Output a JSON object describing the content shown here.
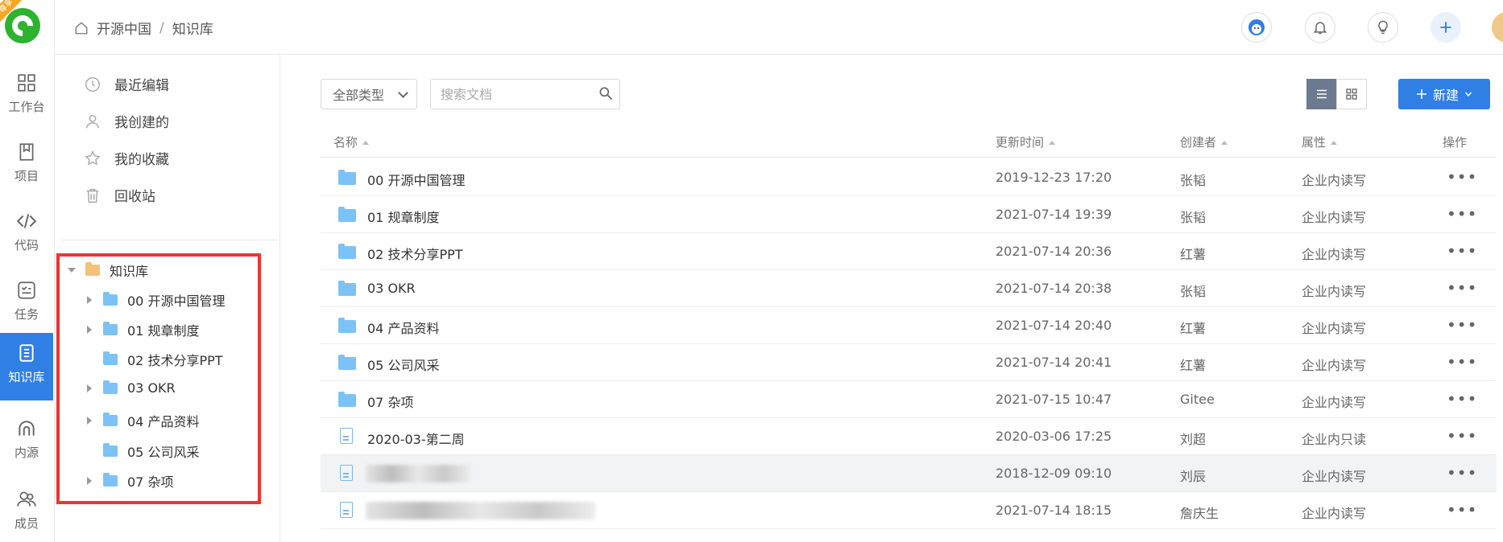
{
  "rail": {
    "badge": "尊享",
    "items": [
      {
        "label": "工作台",
        "icon": "grid-icon"
      },
      {
        "label": "项目",
        "icon": "book-icon"
      },
      {
        "label": "代码",
        "icon": "code-icon"
      },
      {
        "label": "任务",
        "icon": "task-icon"
      },
      {
        "label": "知识库",
        "icon": "doc-icon",
        "active": true
      },
      {
        "label": "内源",
        "icon": "inner-source-icon"
      },
      {
        "label": "成员",
        "icon": "members-icon"
      }
    ]
  },
  "breadcrumb": {
    "root": "开源中国",
    "separator": "/",
    "current": "知识库"
  },
  "side": {
    "menu": [
      "最近编辑",
      "我创建的",
      "我的收藏",
      "回收站"
    ],
    "tree_root": "知识库",
    "tree": [
      {
        "label": "00 开源中国管理",
        "expandable": true
      },
      {
        "label": "01 规章制度",
        "expandable": true
      },
      {
        "label": "02 技术分享PPT",
        "expandable": false
      },
      {
        "label": "03 OKR",
        "expandable": true
      },
      {
        "label": "04 产品资料",
        "expandable": true
      },
      {
        "label": "05 公司风采",
        "expandable": false
      },
      {
        "label": "07 杂项",
        "expandable": true
      }
    ]
  },
  "toolbar": {
    "filter": "全部类型",
    "search_placeholder": "搜索文档",
    "new_label": "新建"
  },
  "table": {
    "headers": {
      "name": "名称",
      "updated": "更新时间",
      "creator": "创建者",
      "attr": "属性",
      "ops": "操作"
    },
    "rows": [
      {
        "type": "folder",
        "name": "00 开源中国管理",
        "updated": "2019-12-23 17:20",
        "creator": "张韬",
        "attr": "企业内读写"
      },
      {
        "type": "folder",
        "name": "01 规章制度",
        "updated": "2021-07-14 19:39",
        "creator": "张韬",
        "attr": "企业内读写"
      },
      {
        "type": "folder",
        "name": "02 技术分享PPT",
        "updated": "2021-07-14 20:36",
        "creator": "红薯",
        "attr": "企业内读写"
      },
      {
        "type": "folder",
        "name": "03 OKR",
        "updated": "2021-07-14 20:38",
        "creator": "张韬",
        "attr": "企业内读写"
      },
      {
        "type": "folder",
        "name": "04 产品资料",
        "updated": "2021-07-14 20:40",
        "creator": "红薯",
        "attr": "企业内读写"
      },
      {
        "type": "folder",
        "name": "05 公司风采",
        "updated": "2021-07-14 20:41",
        "creator": "红薯",
        "attr": "企业内读写"
      },
      {
        "type": "folder",
        "name": "07 杂项",
        "updated": "2021-07-15 10:47",
        "creator": "Gitee",
        "attr": "企业内读写"
      },
      {
        "type": "doc",
        "name": "2020-03-第二周",
        "updated": "2020-03-06 17:25",
        "creator": "刘超",
        "attr": "企业内只读"
      },
      {
        "type": "doc",
        "name": "",
        "updated": "2018-12-09 09:10",
        "creator": "刘辰",
        "attr": "企业内读写"
      },
      {
        "type": "doc",
        "name": "",
        "updated": "2021-07-14 18:15",
        "creator": "詹庆生",
        "attr": "企业内读写"
      }
    ]
  }
}
